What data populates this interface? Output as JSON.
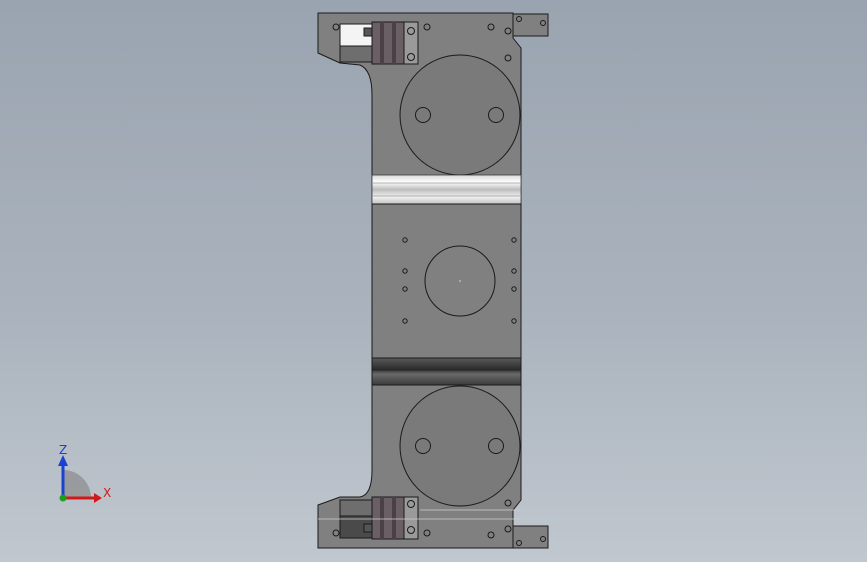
{
  "viewport": {
    "background_top": "#9aa4b0",
    "background_bottom": "#c0c7cf"
  },
  "model": {
    "body_color": "#7f7f7f",
    "edge_color": "#1a1a1a",
    "rail_color": "#e6e6e6",
    "dark_band_color": "#4a4a4a"
  },
  "triad": {
    "x_label": "X",
    "z_label": "Z",
    "x_color": "#d21919",
    "y_color": "#19a019",
    "z_color": "#1941d2"
  }
}
